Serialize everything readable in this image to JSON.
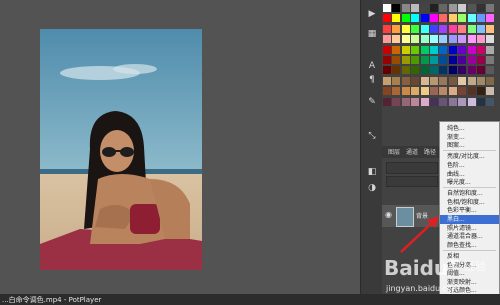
{
  "layers_panel": {
    "tabs": [
      "图层",
      "通道",
      "路径"
    ],
    "layer_name": "背景"
  },
  "context_menu": {
    "items": [
      "纯色...",
      "渐变...",
      "图案...",
      "亮度/对比度...",
      "色阶...",
      "曲线...",
      "曝光度...",
      "自然饱和度...",
      "色相/饱和度...",
      "色彩平衡...",
      "黑白...",
      "照片滤镜...",
      "通道混合器...",
      "颜色查找...",
      "反相",
      "色调分离...",
      "阈值...",
      "渐变映射...",
      "可选颜色..."
    ],
    "selected_index": 10
  },
  "player": {
    "title": "...白命令调色.mp4 - PotPlayer"
  },
  "watermark": {
    "brand": "Baidu",
    "suffix": "经验",
    "url": "jingyan.baidu.com"
  },
  "colors": {
    "workspace": "#535353",
    "panel": "#424242",
    "menu_bg": "#f0f0f0",
    "menu_highlight": "#3c6fd1",
    "arrow": "#e02020"
  }
}
